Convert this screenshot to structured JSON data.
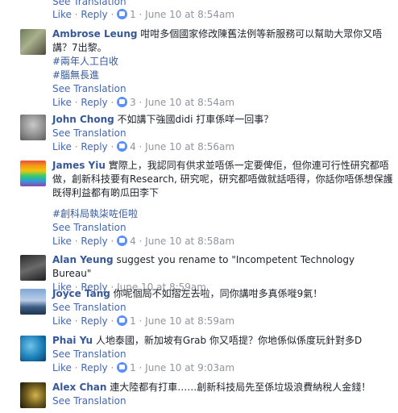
{
  "top": {
    "see_translation": "See Translation",
    "like": "Like",
    "reply": "Reply",
    "count": "1",
    "time": "June 10 at 8:54am"
  },
  "comments": [
    {
      "name": "Ambrose Leung",
      "text": "咁咁多個國家修改陳舊法例等新服務可以幫助大眾你又唔講？7出黎。",
      "tags": [
        "#兩年人工白收",
        "#腦無長進"
      ],
      "see_translation": "See Translation",
      "like": "Like",
      "reply": "Reply",
      "count": "3",
      "time": "June 10 at 8:54am"
    },
    {
      "name": "John Chong",
      "text": "不如講下強國didi 打車係咩一回事？",
      "see_translation": "See Translation",
      "like": "Like",
      "reply": "Reply",
      "count": "4",
      "time": "June 10 at 8:56am"
    },
    {
      "name": "James Yiu",
      "text": "實際上，我認同有供求並唔係一定要俾佢，但你連可行性研究都唔做，創新科技要有Research, 研究呢，研究都唔做就話唔得，你話你唔係想保護既得利益都有啲瓜田李下",
      "tags": [
        "#創科局執柒咗佢啦"
      ],
      "see_translation": "See Translation",
      "like": "Like",
      "reply": "Reply",
      "count": "4",
      "time": "June 10 at 8:58am"
    },
    {
      "name": "Alan Yeung",
      "text": "suggest you rename to \"Incompetent Technology Bureau\"",
      "like": "Like",
      "reply": "Reply",
      "time": "June 10 at 8:59am"
    },
    {
      "name": "Joyce Tang",
      "text": "你呢個局不如摺左去啦，同你講咁多真係嘥9氣！",
      "see_translation": "See Translation",
      "like": "Like",
      "reply": "Reply",
      "count": "1",
      "time": "June 10 at 8:59am"
    },
    {
      "name": "Phai Yu",
      "text": "人地泰國，新加坡有Grab 你又唔提？你地係似係度玩針對多D",
      "see_translation": "See Translation",
      "like": "Like",
      "reply": "Reply",
      "count": "1",
      "time": "June 10 at 9:03am"
    },
    {
      "name": "Alex Chan",
      "text": "連大陸都有打車……創新科技局先至係垃圾浪費納稅人金錢！",
      "see_translation": "See Translation"
    }
  ],
  "colors": {
    "link": "#4267b2",
    "name": "#365899",
    "meta": "#90949c",
    "like_badge": "#5890ff"
  }
}
